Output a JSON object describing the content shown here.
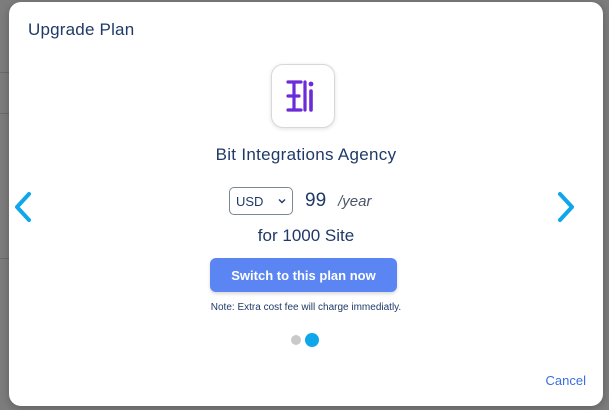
{
  "modal": {
    "title": "Upgrade Plan",
    "plan_name": "Bit Integrations Agency",
    "currency": {
      "selected": "USD"
    },
    "price": {
      "amount": "99",
      "period": "/year"
    },
    "site_count": "for 1000 Site",
    "switch_button_label": "Switch to this plan now",
    "note": "Note: Extra cost fee will charge immediatly.",
    "cancel_label": "Cancel",
    "carousel": {
      "total_slides": 2,
      "active_slide": 2
    }
  },
  "icons": {
    "logo": "bit-integrations-logo-icon",
    "prev": "chevron-left-icon",
    "next": "chevron-right-icon",
    "select": "chevron-down-icon"
  },
  "colors": {
    "accent_blue": "#5a85f2",
    "arrow_cyan": "#10a7ea",
    "title_navy": "#1f3a68",
    "logo_purple": "#6a2bd9"
  }
}
